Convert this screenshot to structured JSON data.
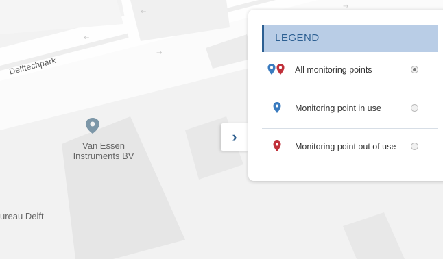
{
  "map": {
    "street_label": "Delftechpark",
    "poi_name": "Van Essen\nInstruments BV",
    "place_label": "ureau Delft"
  },
  "toggle": {
    "icon": "chevron-right-icon",
    "glyph": "›"
  },
  "legend": {
    "title": "LEGEND",
    "items": [
      {
        "label": "All monitoring points",
        "icons": [
          "pin-blue-icon",
          "pin-red-icon"
        ],
        "selected": true
      },
      {
        "label": "Monitoring point in use",
        "icons": [
          "pin-blue-icon"
        ],
        "selected": false
      },
      {
        "label": "Monitoring point out of use",
        "icons": [
          "pin-red-icon"
        ],
        "selected": false
      }
    ]
  },
  "colors": {
    "accent": "#2c5f92",
    "header_bg": "#b9cde6",
    "pin_blue": "#3a7bbf",
    "pin_red": "#c0303a",
    "poi_pin": "#7d97a8"
  }
}
